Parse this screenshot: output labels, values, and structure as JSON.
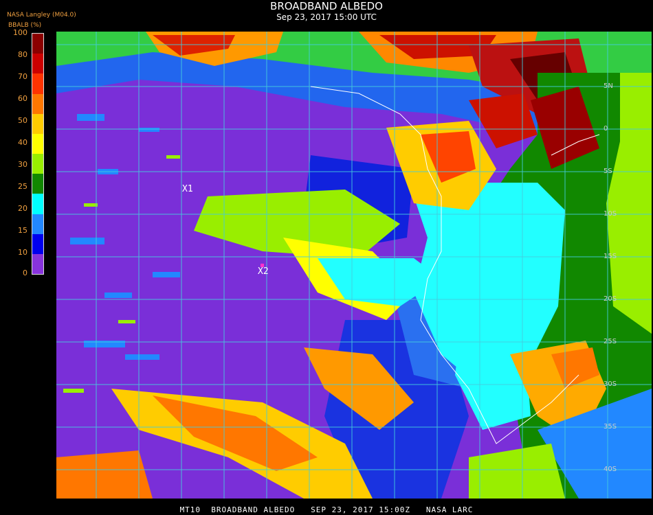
{
  "header": {
    "title": "BROADBAND ALBEDO",
    "subtitle": "Sep 23, 2017 15:00 UTC",
    "source": "NASA Langley (M04.0)",
    "unit": "BBALB (%)"
  },
  "legend": {
    "ticks": [
      "100",
      "80",
      "70",
      "60",
      "50",
      "40",
      "30",
      "25",
      "20",
      "15",
      "10",
      "0"
    ],
    "colors": [
      "#8b0000",
      "#cc0000",
      "#ff3300",
      "#ff7700",
      "#ffcc00",
      "#ffff00",
      "#99ee00",
      "#118800",
      "#00ffff",
      "#2288ff",
      "#0000ee",
      "#8833dd"
    ]
  },
  "map": {
    "points": [
      {
        "id": "x1",
        "label": "X1"
      },
      {
        "id": "x2",
        "label": "X2"
      }
    ],
    "lat_labels": [
      "5N",
      "0",
      "5S",
      "10S",
      "15S",
      "20S",
      "25S",
      "30S",
      "35S",
      "40S"
    ]
  },
  "footer": "MT10  BROADBAND ALBEDO   SEP 23, 2017 15:00Z   NASA LARC"
}
